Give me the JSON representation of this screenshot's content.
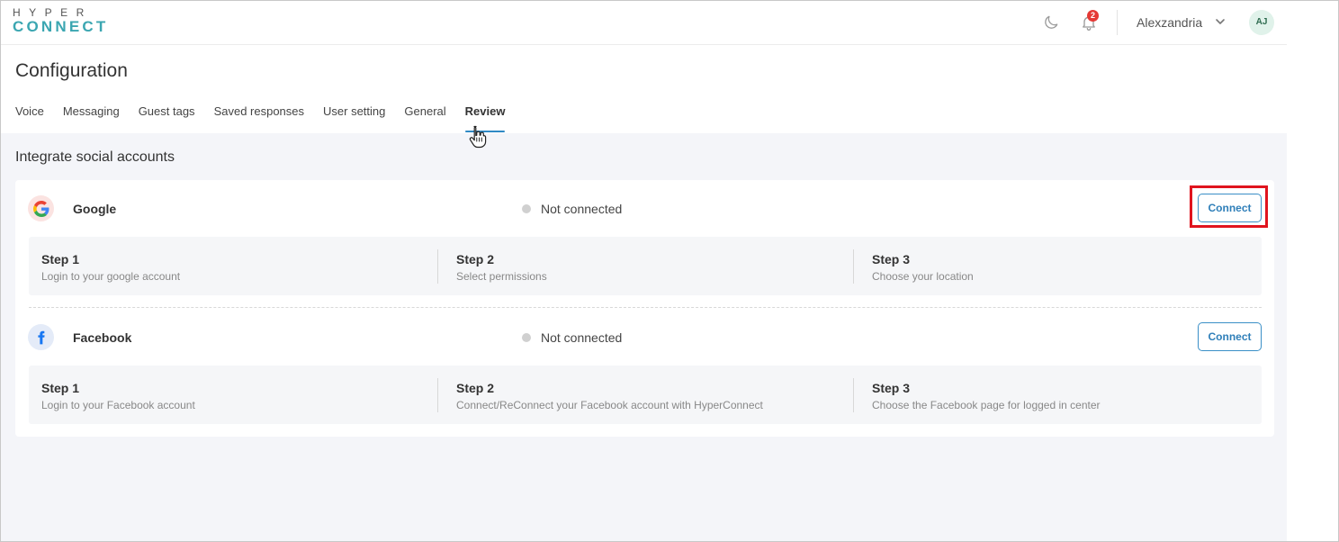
{
  "header": {
    "logo_top": "HYPER",
    "logo_bottom": "CONNECT",
    "notification_count": "2",
    "user_name": "Alexzandria",
    "avatar_initials": "AJ",
    "icons": {
      "theme": "moon-icon",
      "notifications": "bell-icon",
      "user_menu": "chevron-down-icon"
    }
  },
  "page": {
    "title": "Configuration",
    "tabs": [
      {
        "label": "Voice"
      },
      {
        "label": "Messaging"
      },
      {
        "label": "Guest tags"
      },
      {
        "label": "Saved responses"
      },
      {
        "label": "User setting"
      },
      {
        "label": "General"
      },
      {
        "label": "Review",
        "active": true
      }
    ]
  },
  "integrations": {
    "title": "Integrate social accounts",
    "accounts": [
      {
        "name": "Google",
        "icon": "google-icon",
        "status": "Not connected",
        "button_label": "Connect",
        "steps": [
          {
            "title": "Step 1",
            "description": "Login to your google account"
          },
          {
            "title": "Step 2",
            "description": "Select permissions"
          },
          {
            "title": "Step 3",
            "description": "Choose your location"
          }
        ]
      },
      {
        "name": "Facebook",
        "icon": "facebook-icon",
        "status": "Not connected",
        "button_label": "Connect",
        "steps": [
          {
            "title": "Step 1",
            "description": "Login to your Facebook account"
          },
          {
            "title": "Step 2",
            "description": "Connect/ReConnect your Facebook account with HyperConnect"
          },
          {
            "title": "Step 3",
            "description": "Choose the Facebook page for logged in center"
          }
        ]
      }
    ]
  },
  "colors": {
    "accent": "#2f89c5",
    "logo_teal": "#3ba6b1",
    "badge": "#e53935",
    "highlight": "#e0141e",
    "status_dot": "#d0d0d0"
  }
}
